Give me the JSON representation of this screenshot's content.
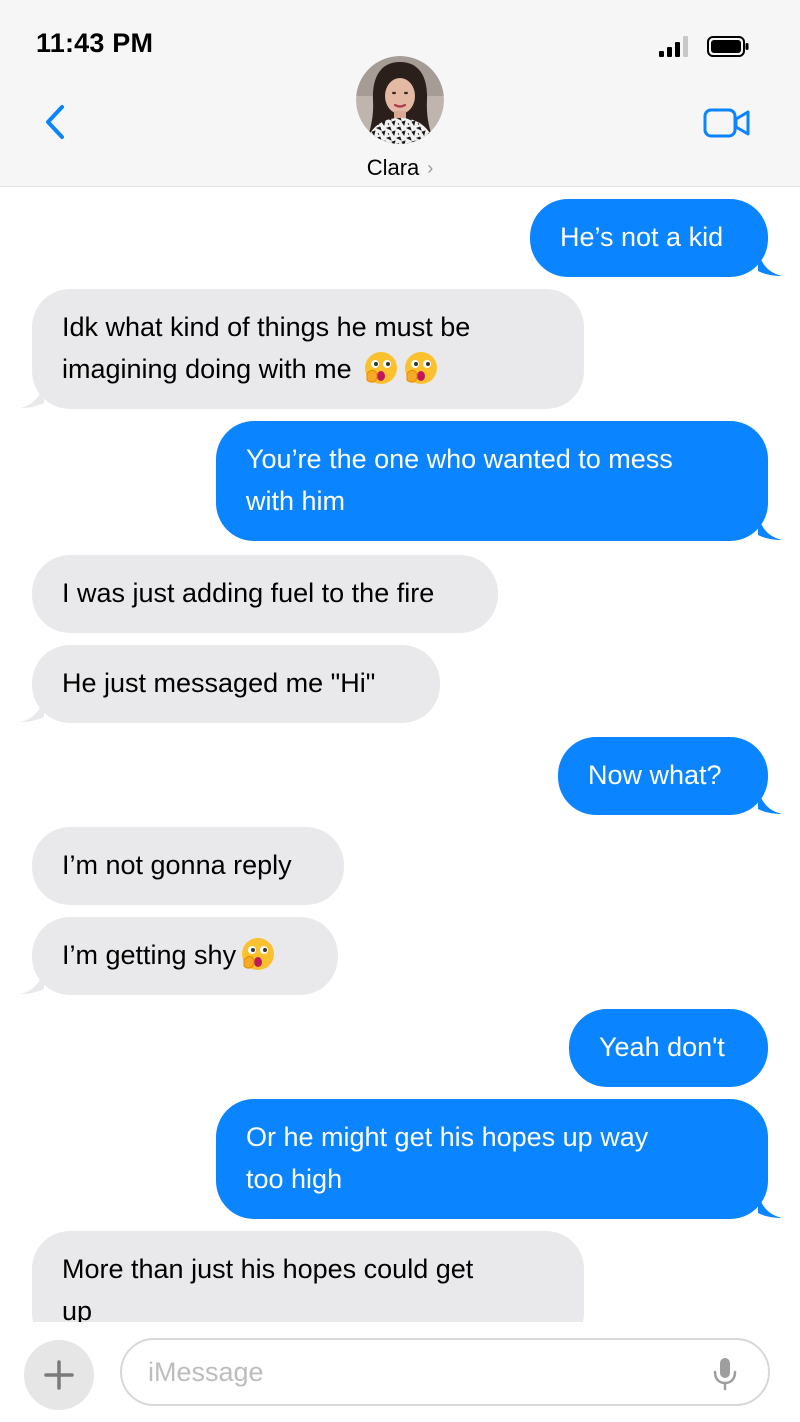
{
  "status_bar": {
    "time": "11:43 PM"
  },
  "header": {
    "contact_name": "Clara",
    "chevron_glyph": "›",
    "back_icon": "chevron-left-icon",
    "video_icon": "video-camera-icon"
  },
  "colors": {
    "accent": "#0a84ff",
    "incoming_bubble": "#e9e9eb",
    "header_bg": "#f6f6f6"
  },
  "messages": [
    {
      "direction": "out",
      "text": "He’s not a kid",
      "emoji_count": 0
    },
    {
      "direction": "in",
      "line1": "Idk what kind of things he must be",
      "line2": "imagining doing with me",
      "emoji_count": 2,
      "emoji": "face-with-open-eyes-and-hand-over-mouth"
    },
    {
      "direction": "out",
      "line1": "You’re the one who wanted to mess",
      "line2": "with him",
      "emoji_count": 0
    },
    {
      "direction": "in",
      "text": "I was just adding fuel to the fire",
      "emoji_count": 0
    },
    {
      "direction": "in",
      "text": "He just messaged me \"Hi\"",
      "emoji_count": 0
    },
    {
      "direction": "out",
      "text": "Now what?",
      "emoji_count": 0
    },
    {
      "direction": "in",
      "text": "I’m not gonna reply",
      "emoji_count": 0
    },
    {
      "direction": "in",
      "text": "I’m getting shy",
      "emoji_count": 1,
      "emoji": "face-with-open-eyes-and-hand-over-mouth"
    },
    {
      "direction": "out",
      "text": "Yeah don't",
      "emoji_count": 0
    },
    {
      "direction": "out",
      "line1": "Or he might get his hopes up way",
      "line2": "too high",
      "emoji_count": 0
    },
    {
      "direction": "in",
      "line1": "More than just his hopes could get",
      "line2": "up",
      "emoji_count": 0
    }
  ],
  "composer": {
    "placeholder": "iMessage",
    "plus_icon": "plus-icon",
    "mic_icon": "microphone-icon"
  }
}
